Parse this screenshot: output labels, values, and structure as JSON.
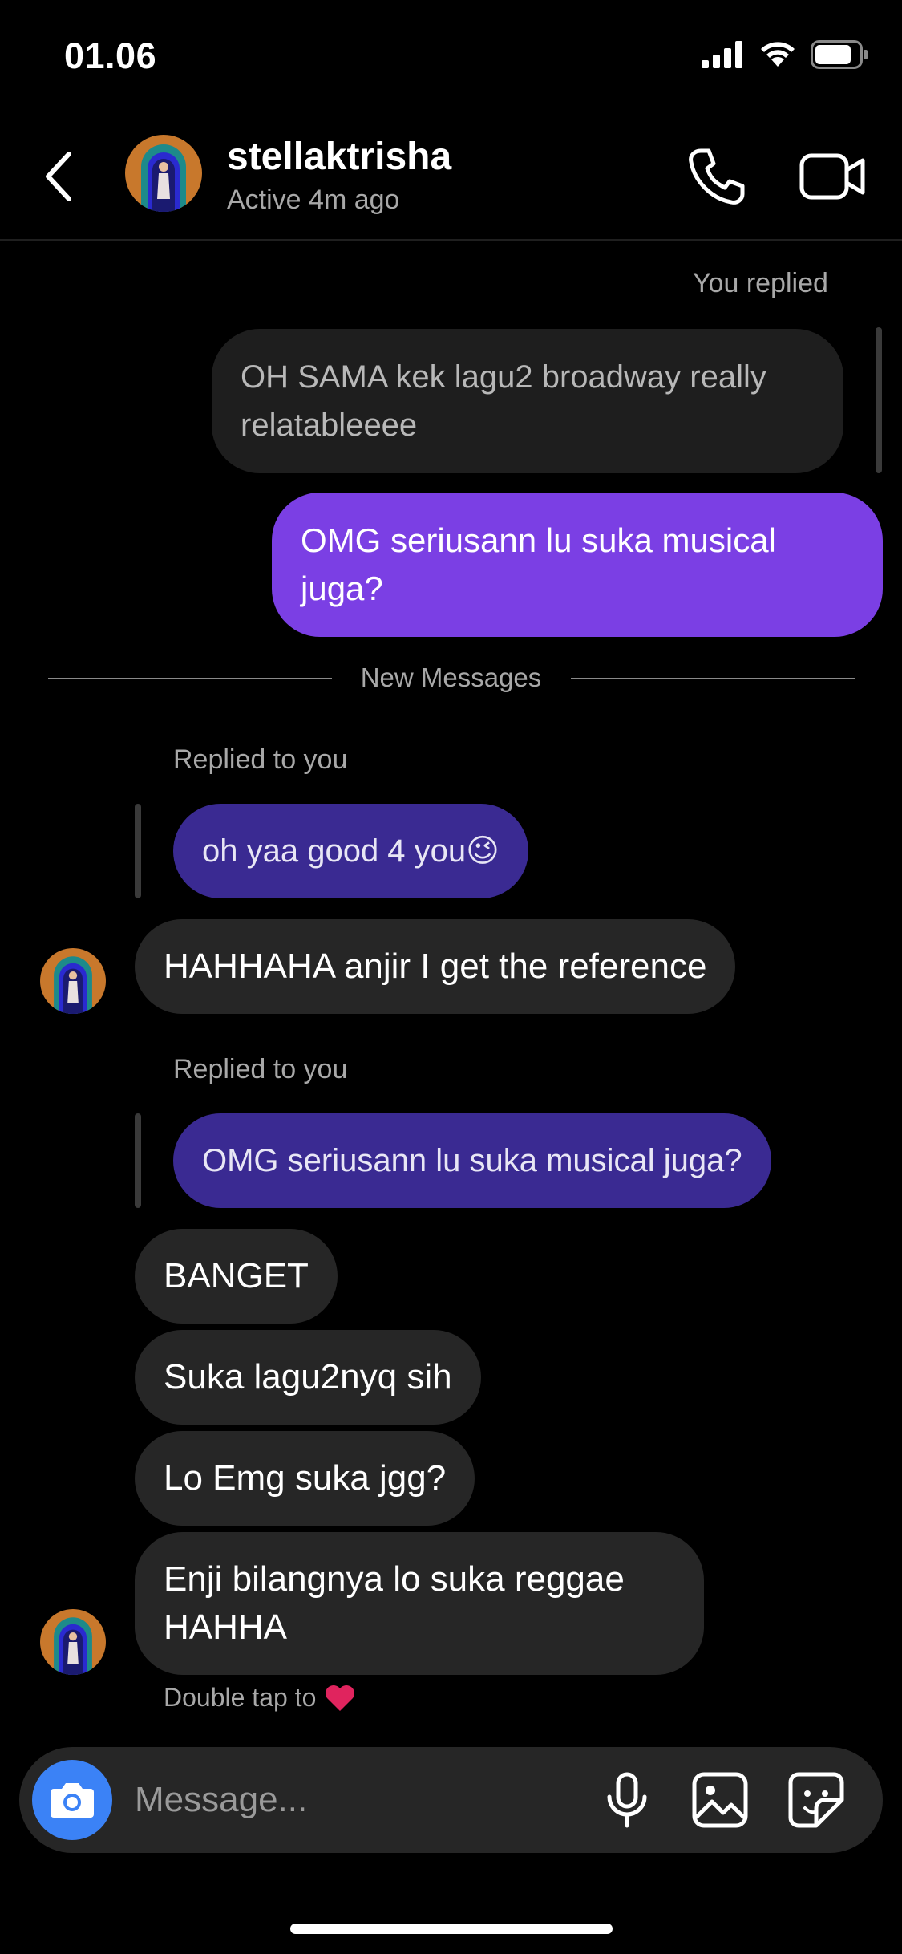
{
  "status_bar": {
    "time": "01.06"
  },
  "header": {
    "username": "stellaktrisha",
    "active": "Active 4m ago"
  },
  "thread": {
    "you_replied_label": "You replied",
    "quoted_message": "OH SAMA kek lagu2 broadway really relatableeee",
    "sent_message": "OMG seriusann lu suka musical juga?",
    "new_messages_label": "New Messages",
    "replied_label_1": "Replied to you",
    "reply_quote_1": "oh yaa good 4 you😉",
    "message_1": "HAHHAHA anjir I get the reference",
    "replied_label_2": "Replied to you",
    "reply_quote_2": "OMG seriusann lu suka musical juga?",
    "message_2": "BANGET",
    "message_3": "Suka lagu2nyq sih",
    "message_4": "Lo Emg suka jgg?",
    "message_5": "Enji bilangnya lo suka reggae HAHHA",
    "double_tap_hint": "Double tap to"
  },
  "composer": {
    "placeholder": "Message..."
  },
  "colors": {
    "sent_bubble": "#7b3fe4",
    "reply_bubble": "#3a2a92",
    "received_bubble": "#262626",
    "camera_button": "#3b82f6",
    "heart": "#e0245e"
  },
  "icons": [
    "back-chevron-icon",
    "phone-icon",
    "video-camera-icon",
    "camera-icon",
    "microphone-icon",
    "gallery-icon",
    "sticker-icon",
    "heart-icon"
  ]
}
